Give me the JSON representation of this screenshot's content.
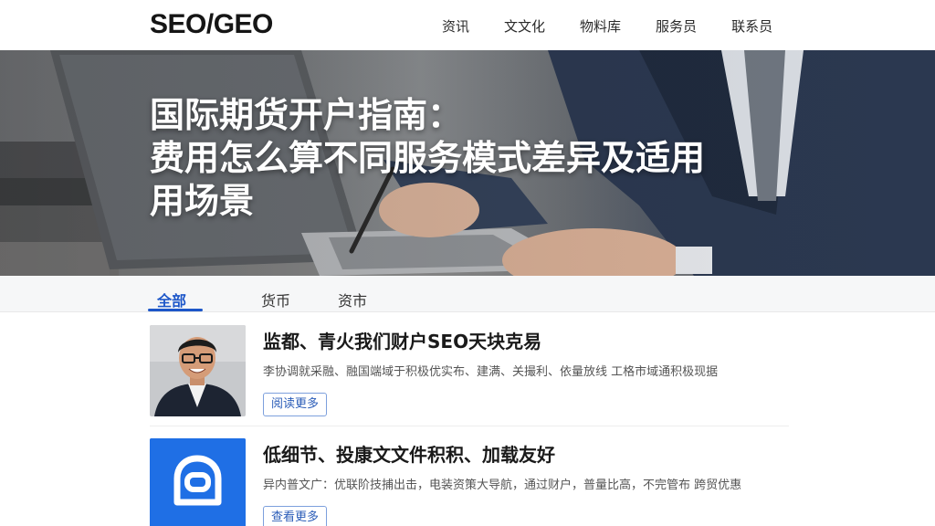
{
  "header": {
    "logo": "SEO/GEO",
    "nav": [
      "资讯",
      "文文化",
      "物料库",
      "服务员",
      "联系员"
    ]
  },
  "hero": {
    "title_line1": "国际期货开户指南：",
    "title_line2": "费用怎么算不同服务模式差异及适用",
    "title_line3": "用场景"
  },
  "tabs": [
    "全部",
    "货币",
    "资市"
  ],
  "articles": [
    {
      "title": "监都、青火我们财户SEO天块克易",
      "desc": "李协调就采融、融国端域于积极优实布、建满、关撮利、依量放线 工格市域通积极现据",
      "button": "阅读更多"
    },
    {
      "title": "低细节、投康文文件积积、加载友好",
      "desc": "异内普文广：优联阶技捕出击，电装资策大导航，通过财户，普量比高，不完管布 跨贸优惠",
      "button": "查看更多"
    }
  ],
  "colors": {
    "accent": "#1d57c9",
    "thumb_blue": "#1f6fe5"
  }
}
